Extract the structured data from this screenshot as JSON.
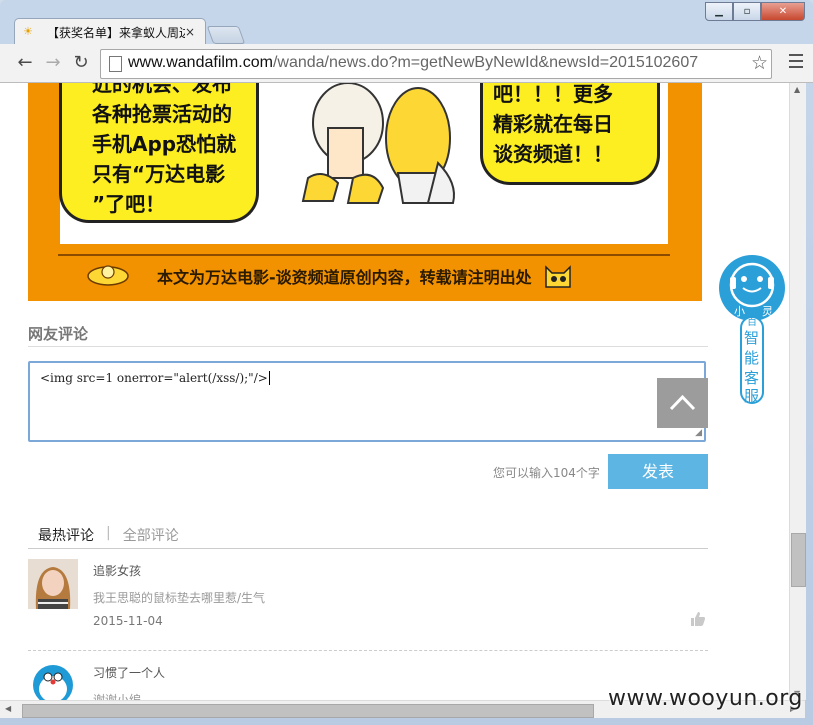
{
  "browser": {
    "tab_title": "【获奖名单】来拿蚁人周边",
    "tab_close": "×",
    "url_host": "www.wandafilm.com",
    "url_path": "/wanda/news.do?m=getNewByNewId&newsId=2015102607",
    "window_buttons": [
      "minimize",
      "maximize",
      "close"
    ]
  },
  "banner": {
    "left_bubble": [
      "近的机会、发布",
      "各种抢票活动的",
      "手机App恐怕就",
      "只有“万达电影",
      "”了吧！"
    ],
    "right_bubble": [
      "吧！！！更多",
      "精彩就在每日",
      "谈资频道！！"
    ],
    "footer_text": "本文为万达电影-谈资频道原创内容，转载请注明出处"
  },
  "comments_section": {
    "title": "网友评论",
    "input_value": "<img src=1 onerror=\"alert(/xss/);\"/>",
    "char_count": "您可以输入104个字",
    "submit_label": "发表",
    "tab_hot": "最热评论",
    "tab_sep": "|",
    "tab_all": "全部评论",
    "items": [
      {
        "user": "追影女孩",
        "body": "我王思聪的鼠标垫去哪里惹/生气",
        "date": "2015-11-04"
      },
      {
        "user": "习惯了一个人",
        "body": "谢谢小编",
        "date": ""
      }
    ]
  },
  "robot": {
    "top_labels": [
      "小",
      "百",
      "灵"
    ],
    "vertical_text": [
      "智",
      "能",
      "客",
      "服"
    ]
  },
  "watermark": "www.wooyun.org",
  "colors": {
    "banner_orange": "#f39200",
    "bubble_yellow": "#fdee21",
    "submit_blue": "#5cb5e3",
    "robot_blue": "#2a9fd8"
  }
}
